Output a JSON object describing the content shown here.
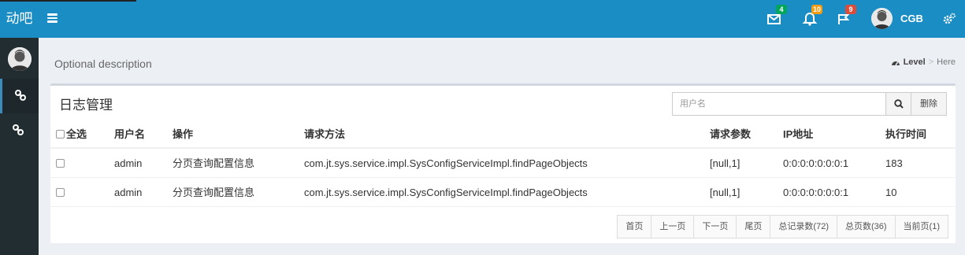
{
  "brand": {
    "logo": "动吧"
  },
  "topbar": {
    "messages_count": "4",
    "notifications_count": "10",
    "tasks_count": "9",
    "user_name": "CGB",
    "colors": {
      "bar": "#1a8ec4",
      "messages": "#00a65a",
      "notifications": "#f39c12",
      "tasks": "#dd4b39"
    }
  },
  "header": {
    "description": "Optional description",
    "breadcrumb": {
      "level": "Level",
      "separator": ">",
      "here": "Here"
    }
  },
  "box": {
    "title": "日志管理",
    "search_placeholder": "用户名",
    "delete_label": "删除"
  },
  "table": {
    "headers": {
      "select_all": "全选",
      "username": "用户名",
      "operation": "操作",
      "method": "请求方法",
      "params": "请求参数",
      "ip": "IP地址",
      "time": "执行时间"
    },
    "rows": [
      {
        "username": "admin",
        "operation": "分页查询配置信息",
        "method": "com.jt.sys.service.impl.SysConfigServiceImpl.findPageObjects",
        "params": "[null,1]",
        "ip": "0:0:0:0:0:0:0:1",
        "time": "183"
      },
      {
        "username": "admin",
        "operation": "分页查询配置信息",
        "method": "com.jt.sys.service.impl.SysConfigServiceImpl.findPageObjects",
        "params": "[null,1]",
        "ip": "0:0:0:0:0:0:0:1",
        "time": "10"
      }
    ]
  },
  "pagination": {
    "first": "首页",
    "prev": "上一页",
    "next": "下一页",
    "last": "尾页",
    "total_records": "总记录数(72)",
    "total_pages": "总页数(36)",
    "current_page": "当前页(1)"
  }
}
